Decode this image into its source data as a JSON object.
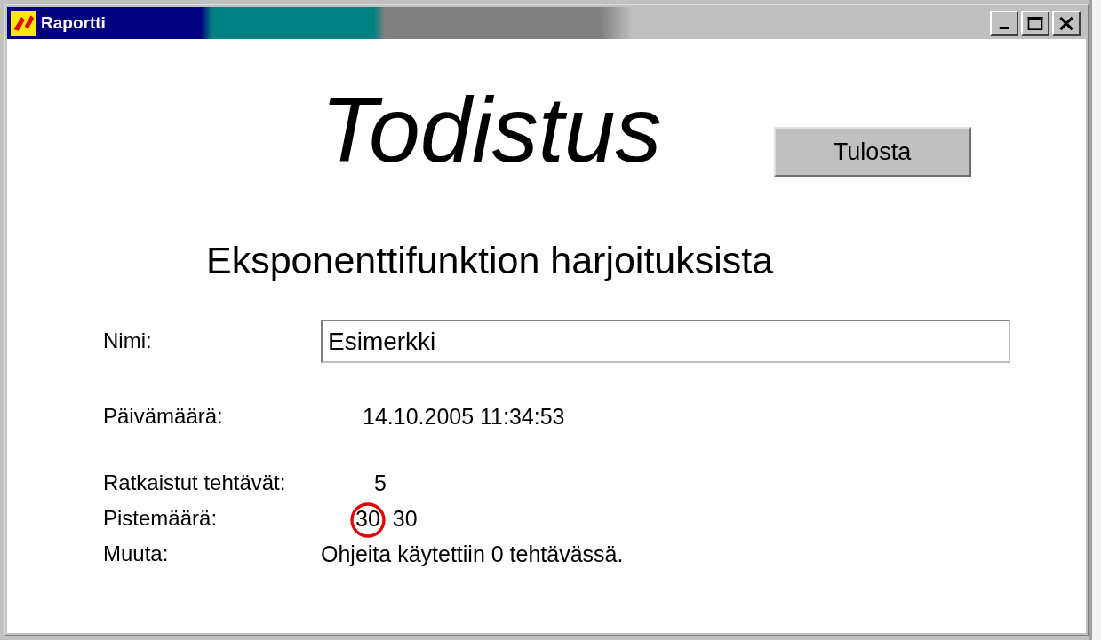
{
  "window": {
    "title": "Raportti"
  },
  "heading": "Todistus",
  "print_button": "Tulosta",
  "subtitle": "Eksponenttifunktion harjoituksista",
  "name_field": {
    "label": "Nimi:",
    "value": "Esimerkki"
  },
  "date": {
    "label": "Päivämäärä:",
    "value": "14.10.2005 11:34:53"
  },
  "solved": {
    "label": "Ratkaistut tehtävät:",
    "value": "5"
  },
  "score": {
    "label": "Pistemäärä:",
    "points": "30",
    "total": "30",
    "circled": true
  },
  "other": {
    "label": "Muuta:",
    "value": "Ohjeita käytettiin 0 tehtävässä."
  }
}
